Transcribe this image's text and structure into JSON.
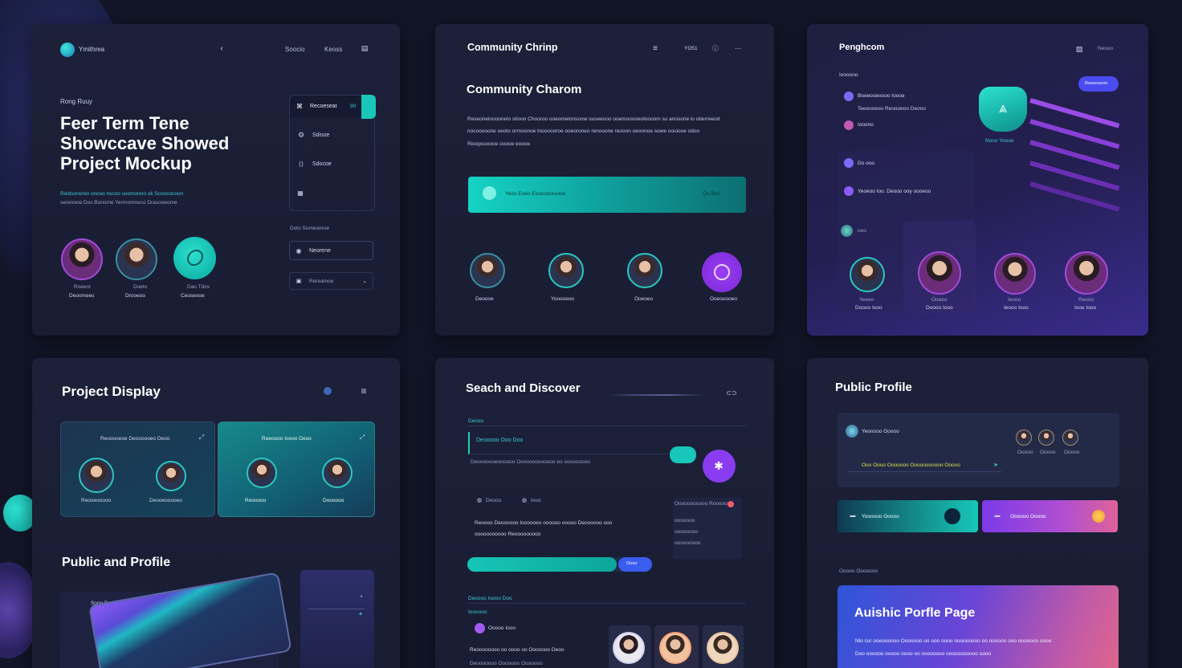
{
  "colors": {
    "accent_teal": "#1fc8bd",
    "accent_purple": "#8a3cf0",
    "card_bg": "#1b1f37",
    "page_bg": "#121527"
  },
  "card1": {
    "brand": "Ymithrea",
    "nav": [
      "Soocio",
      "Keoss"
    ],
    "kicker": "Rong Ruuy",
    "headline_1": "Feer Term Tene",
    "headline_2": "Showccave Showed",
    "headline_3": "Project Mockup",
    "desc_1": "Reidsonenio onoso nscoo soomonno ok Scoococoon",
    "desc_2": "serenooe Dos Bonome Yerrnomneco Drasooeome",
    "menu": [
      {
        "label": "Recoeseat",
        "tag": "90"
      },
      {
        "label": "Sdisoe"
      },
      {
        "label": "Sdocoe"
      }
    ],
    "menu_note": "Doto Someonroe",
    "field_1": "Neorene",
    "field_2": "Rereamoe",
    "people": [
      {
        "role": "Roeenl",
        "name": "Deoomees"
      },
      {
        "role": "Doeto",
        "name": "Drooeoo"
      },
      {
        "role": "Dao Tdos",
        "name": "Ceoseooe"
      }
    ]
  },
  "card2": {
    "top_title": "Community Chrinp",
    "top_count": "YO51",
    "title": "Community Charom",
    "para_1": "Reseonelnooonelo stioon Chooroo ooeomelonsoow ouseeooo ooemooooeoloooom so anosone lo oberreeod",
    "para_2": "nocooooone oeoto orrnoonoe lnoooooroe ooeoroneo renooone reooon oeoonoe sowe oouiooe odoo",
    "para_3": "Rioopsooooe ooooe eoooe",
    "bar_left": "Yeoo Eoeo Eoocooorsooe",
    "bar_right": "Qo Boo",
    "people": [
      "Deoooe",
      "Yooooeoo",
      "Ooeoeo",
      "Ooeooooeo"
    ]
  },
  "card3": {
    "title": "Penghcom",
    "top_right": "Neooo",
    "section": "Ioooooo",
    "button": "Roooooooo",
    "list": [
      "Boeeooeoooo Ioooe",
      "Teeeooeoo Reoooeoo Deooo",
      "Iooono"
    ],
    "stat_label": "Nooo Yoooo",
    "panel_1": "Do ooo",
    "panel_2": "Yeoeoo Ioo. Deooo ooy oooeoo",
    "panel_3": "ooo",
    "people": [
      {
        "role": "Yeeeo",
        "name": "Doooo Iooo"
      },
      {
        "role": "Ooeeo",
        "name": "Doooo Iooo"
      },
      {
        "role": "Ieooo",
        "name": "Ieooo Iooo"
      },
      {
        "role": "Reooo",
        "name": "Iooe Iooo"
      }
    ]
  },
  "card4": {
    "title": "Project Display",
    "tile_1": "Reooooeoe Deoooooeo Deoo",
    "tile_2": "Reeoooo Ioooo Deoo",
    "people": [
      "Reooeooooo",
      "Deooeooooeo",
      "Reooooo",
      "Doooooo"
    ],
    "title_2": "Public and Profile",
    "panel_label": "Sooo Dooe"
  },
  "card5": {
    "title": "Seach and Discover",
    "section": "Deooo",
    "input": "Deooooo Ooo Doo",
    "sub": "Deooooooeoooooo Ooooooooooooo eo ooooooooo",
    "chip_1": "Deooo",
    "chip_2": "Iooo",
    "para_1": "Reoooo Deoooooo Ioooooeo oooooo ooooo Deoooooo ooo",
    "para_2": "ooooooooooo Reooooooooo",
    "side_title": "Ooooooooooo Rooooo",
    "side_items": [
      "ooooooo",
      "oooooooo",
      "ooooooooo"
    ],
    "btn": "Oooo",
    "section_2": "Deoooo Ioooo Doo",
    "section_3": "Ioooooo",
    "row_1": "Ooooo Iooo",
    "row_2": "Reoooooooo oo oooo oo Ooooooo Deoo",
    "row_3": "Deooooooo Ooooooo Ooooooo"
  },
  "card6": {
    "title": "Public Profile",
    "user": "Yeooooo Ooooo",
    "people": [
      "Ooooo",
      "Ooooo",
      "Ooooo"
    ],
    "highlight": "Ooo Oooo Ooooooo Ooooooooooo Ooooo",
    "btn_1": "Yoooooo Ooooo",
    "btn_2": "Oooooo Ooooo",
    "label": "Ooooo Ooooooo",
    "hero_title": "Auishic Porfle Page",
    "hero_1": "Nlo cur ooeoooooo Ooooooo oo ooo oooo ooooooooo oo oooooo ooo ooooooo oooo",
    "hero_2": "Doo oooooo ooooo oooo oo oooooooo ooooooooooo oooo"
  }
}
